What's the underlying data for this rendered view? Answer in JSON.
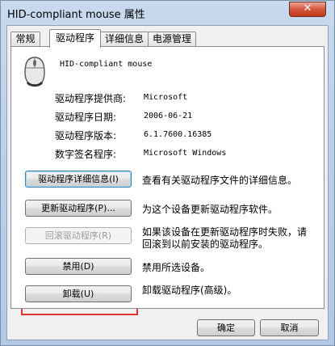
{
  "window": {
    "title": "HID-compliant mouse 属性",
    "close_glyph": "✕"
  },
  "tabs": [
    {
      "label": "常规"
    },
    {
      "label": "驱动程序",
      "selected": true
    },
    {
      "label": "详细信息"
    },
    {
      "label": "电源管理"
    }
  ],
  "device": {
    "icon": "mouse-icon",
    "name": "HID-compliant mouse"
  },
  "driver_info": [
    {
      "label": "驱动程序提供商:",
      "value": "Microsoft"
    },
    {
      "label": "驱动程序日期:",
      "value": "2006-06-21"
    },
    {
      "label": "驱动程序版本:",
      "value": "6.1.7600.16385"
    },
    {
      "label": "数字签名程序:",
      "value": "Microsoft Windows"
    }
  ],
  "actions": {
    "details": {
      "button": "驱动程序详细信息(I)",
      "description": "查看有关驱动程序文件的详细信息。"
    },
    "update": {
      "button": "更新驱动程序(P)...",
      "description": "为这个设备更新驱动程序软件。"
    },
    "rollback": {
      "button": "回滚驱动程序(R)",
      "description_line1": "如果该设备在更新驱动程序时失败，请",
      "description_line2": "回滚到以前安装的驱动程序。"
    },
    "disable": {
      "button": "禁用(D)",
      "description": "禁用所选设备。"
    },
    "uninstall": {
      "button": "卸载(U)",
      "description": "卸载驱动程序(高级)。"
    }
  },
  "footer": {
    "ok": "确定",
    "cancel": "取消"
  },
  "colors": {
    "highlight_box": "#e53333",
    "dialog_bg": "#f0f0f0"
  }
}
